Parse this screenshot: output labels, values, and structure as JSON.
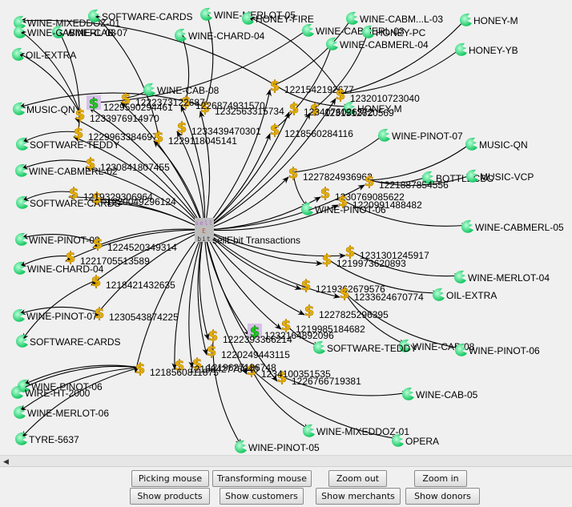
{
  "window": {
    "title": "sellEbit Transactions"
  },
  "graph": {
    "root": {
      "label": "sellEbit Transactions",
      "logo_lines": [
        "sell",
        "E",
        "bit"
      ]
    },
    "transactions": [
      {
        "id": "1221542192677"
      },
      {
        "id": "1232010723040"
      },
      {
        "id": "1231512620569"
      },
      {
        "id": "1218560284116"
      },
      {
        "id": "1227824936962"
      },
      {
        "id": "1230769085622"
      },
      {
        "id": "1221887854556"
      },
      {
        "id": "1220991488482"
      },
      {
        "id": "1231301245917"
      },
      {
        "id": "1219973620893"
      },
      {
        "id": "1219362679576"
      },
      {
        "id": "1233624670774"
      },
      {
        "id": "1227825296395"
      },
      {
        "id": "1219985184682"
      },
      {
        "id": "1232164892096"
      },
      {
        "id": "1226766719381"
      },
      {
        "id": "1234100351535"
      },
      {
        "id": "1222393366214"
      },
      {
        "id": "1220249443115"
      },
      {
        "id": "1219627136748"
      },
      {
        "id": "1218642776640"
      },
      {
        "id": "1218560811875"
      },
      {
        "id": "1224520349314"
      },
      {
        "id": "1221705513589"
      },
      {
        "id": "1218421432635"
      },
      {
        "id": "1230543874225"
      },
      {
        "id": "1220049296124"
      },
      {
        "id": "1219329306964"
      },
      {
        "id": "1230841807455"
      },
      {
        "id": "1229963384697"
      },
      {
        "id": "1229118045141"
      },
      {
        "id": "1233439470301"
      },
      {
        "id": "1233976914970"
      },
      {
        "id": "1232563315734"
      },
      {
        "id": "1226874931570"
      },
      {
        "id": "1222373122687"
      },
      {
        "id": "1229590294461"
      },
      {
        "id": "1234076026372"
      }
    ],
    "products": [
      {
        "label": "WINE-MIXEDDOZ-01"
      },
      {
        "label": "SOFTWARE-CARDS"
      },
      {
        "label": "WINE-CAB-07"
      },
      {
        "label": "WINE-MERLOT-05"
      },
      {
        "label": "HONEY-FIRE"
      },
      {
        "label": "WINE-CABMERL-03"
      },
      {
        "label": "WINE-CHARD-04"
      },
      {
        "label": "WINE-CABMERL-03"
      },
      {
        "label": "OIL-EXTRA"
      },
      {
        "label": "WINE-CABM...L-03"
      },
      {
        "label": "HONEY-M"
      },
      {
        "label": "HONEY-PC"
      },
      {
        "label": "WINE-CABMERL-04"
      },
      {
        "label": "HONEY-YB"
      },
      {
        "label": "WINE-CAB-08"
      },
      {
        "label": "MUSIC-QN"
      },
      {
        "label": "HONEY-M"
      },
      {
        "label": "WINE-PINOT-07"
      },
      {
        "label": "SOFTWARE-TEDDY"
      },
      {
        "label": "MUSIC-QN"
      },
      {
        "label": "WINE-CABMERL-02"
      },
      {
        "label": "BOTTLECBC"
      },
      {
        "label": "MUSIC-VCP"
      },
      {
        "label": "SOFTWARE-CARDS"
      },
      {
        "label": "WINE-PINOT-06"
      },
      {
        "label": "WINE-CABMERL-05"
      },
      {
        "label": "WINE-PINOT-08"
      },
      {
        "label": "WINE-CHARD-04"
      },
      {
        "label": "WINE-MERLOT-04"
      },
      {
        "label": "OIL-EXTRA"
      },
      {
        "label": "WINE-PINOT-07"
      },
      {
        "label": "SOFTWARE-CARDS"
      },
      {
        "label": "WINE-CAB-08"
      },
      {
        "label": "WINE-PINOT-06"
      },
      {
        "label": "SOFTWARE-TEDDY"
      },
      {
        "label": "WINE-PINOT-06"
      },
      {
        "label": "WIRE-HT-2000"
      },
      {
        "label": "WINE-MERLOT-06"
      },
      {
        "label": "WINE-CAB-05"
      },
      {
        "label": "TYRE-5637"
      },
      {
        "label": "WINE-MIXEDDOZ-01"
      },
      {
        "label": "OPERA"
      },
      {
        "label": "WINE-PINOT-05"
      }
    ]
  },
  "buttons": {
    "row1": [
      {
        "label": "Picking mouse"
      },
      {
        "label": "Transforming mouse"
      },
      {
        "label": "Zoom out"
      },
      {
        "label": "Zoom in"
      }
    ],
    "row2": [
      {
        "label": "Show products"
      },
      {
        "label": "Show customers"
      },
      {
        "label": "Show merchants"
      },
      {
        "label": "Show donors"
      }
    ]
  },
  "colors": {
    "edge": "#000000",
    "product_icon": "#2ee07a",
    "transaction_icon": "#f2c21a",
    "merchant_icon": "#22cc22",
    "merchant_bg": "#d8c0e8",
    "background": "#f0f0f0"
  }
}
